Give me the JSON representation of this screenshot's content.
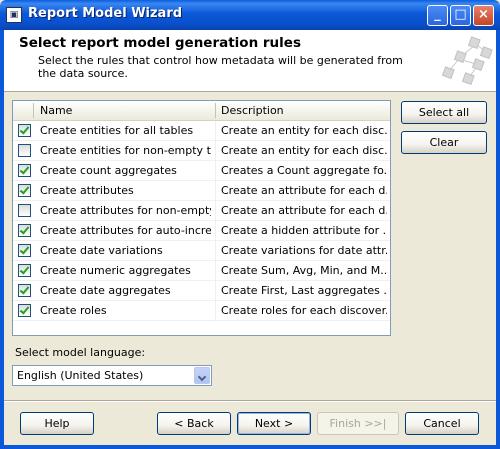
{
  "window": {
    "title": "Report Model Wizard",
    "icon": "wizard-app-icon"
  },
  "header": {
    "title": "Select report model generation rules",
    "description": "Select the rules that control how metadata will be generated from the data source."
  },
  "rules_list": {
    "columns": [
      "Name",
      "Description"
    ],
    "rows": [
      {
        "checked": true,
        "name": "Create entities for all tables",
        "description": "Create an entity for each disc..."
      },
      {
        "checked": false,
        "name": "Create entities for non-empty ta...",
        "description": "Create an entity for each disc..."
      },
      {
        "checked": true,
        "name": "Create count aggregates",
        "description": "Creates a Count aggregate fo..."
      },
      {
        "checked": true,
        "name": "Create attributes",
        "description": "Create an attribute for each d..."
      },
      {
        "checked": false,
        "name": "Create attributes for non-empty...",
        "description": "Create an attribute for each d..."
      },
      {
        "checked": true,
        "name": "Create attributes for auto-incre...",
        "description": "Create a hidden attribute for ..."
      },
      {
        "checked": true,
        "name": "Create date variations",
        "description": "Create variations for date attr..."
      },
      {
        "checked": true,
        "name": "Create numeric aggregates",
        "description": "Create Sum, Avg, Min, and M..."
      },
      {
        "checked": true,
        "name": "Create date aggregates",
        "description": "Create First, Last aggregates ..."
      },
      {
        "checked": true,
        "name": "Create roles",
        "description": "Create roles for each discover..."
      }
    ]
  },
  "side_buttons": {
    "select_all": "Select all",
    "clear": "Clear"
  },
  "language": {
    "label": "Select model language:",
    "value": "English (United States)"
  },
  "footer": {
    "help": "Help",
    "back": "< Back",
    "next": "Next >",
    "finish": "Finish >>|",
    "cancel": "Cancel"
  }
}
